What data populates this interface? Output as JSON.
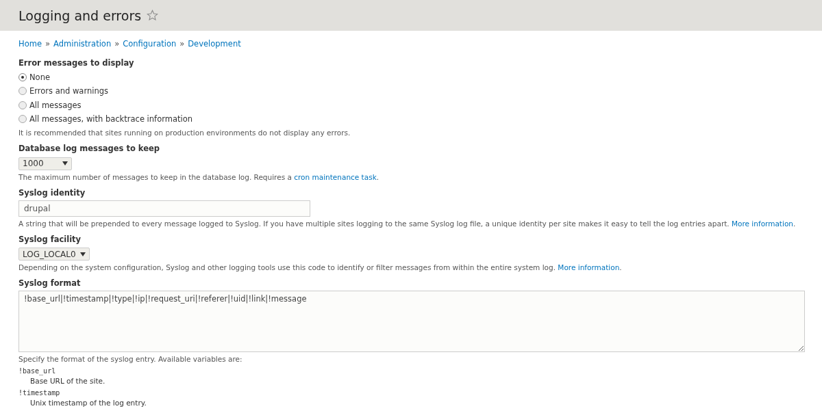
{
  "page": {
    "title": "Logging and errors"
  },
  "breadcrumb": {
    "separator": "»",
    "items": [
      "Home",
      "Administration",
      "Configuration",
      "Development"
    ]
  },
  "fields": [
    {
      "kind": "radios",
      "label": "Error messages to display",
      "options": [
        {
          "label": "None",
          "selected": true
        },
        {
          "label": "Errors and warnings",
          "selected": false
        },
        {
          "label": "All messages",
          "selected": false
        },
        {
          "label": "All messages, with backtrace information",
          "selected": false
        }
      ],
      "description": [
        {
          "kind": "text",
          "text": "It is recommended that sites running on production environments do not display any errors."
        }
      ]
    },
    {
      "kind": "select",
      "label": "Database log messages to keep",
      "value": "1000",
      "description": [
        {
          "kind": "text",
          "text": "The maximum number of messages to keep in the database log. Requires a "
        },
        {
          "kind": "link",
          "text": "cron maintenance task"
        },
        {
          "kind": "text",
          "text": "."
        }
      ]
    },
    {
      "kind": "text",
      "label": "Syslog identity",
      "value": "drupal",
      "description": [
        {
          "kind": "text",
          "text": "A string that will be prepended to every message logged to Syslog. If you have multiple sites logging to the same Syslog log file, a unique identity per site makes it easy to tell the log entries apart. "
        },
        {
          "kind": "link",
          "text": "More information"
        },
        {
          "kind": "text",
          "text": "."
        }
      ]
    },
    {
      "kind": "select",
      "label": "Syslog facility",
      "value": "LOG_LOCAL0",
      "description": [
        {
          "kind": "text",
          "text": "Depending on the system configuration, Syslog and other logging tools use this code to identify or filter messages from within the entire system log. "
        },
        {
          "kind": "link",
          "text": "More information"
        },
        {
          "kind": "text",
          "text": "."
        }
      ]
    },
    {
      "kind": "textarea",
      "label": "Syslog format",
      "value": "!base_url|!timestamp|!type|!ip|!request_uri|!referer|!uid|!link|!message",
      "description": [
        {
          "kind": "text",
          "text": "Specify the format of the syslog entry. Available variables are:"
        }
      ],
      "variables": [
        {
          "name": "!base_url",
          "description": "Base URL of the site."
        },
        {
          "name": "!timestamp",
          "description": "Unix timestamp of the log entry."
        }
      ]
    }
  ]
}
